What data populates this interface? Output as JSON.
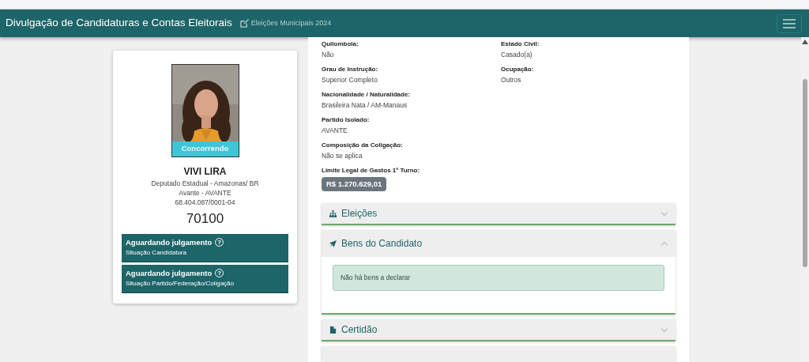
{
  "navbar": {
    "title": "Divulgação de Candidaturas e Contas Eleitorais",
    "subtitle": "Eleições Municipais 2024"
  },
  "candidate": {
    "status_band": "Concorrendo",
    "name": "VIVI LIRA",
    "office": "Deputado Estadual - Amazonas/ BR",
    "party": "Avante - AVANTE",
    "cnpj": "68.404.087/0001-04",
    "number": "70100",
    "situations": [
      {
        "title": "Aguardando julgamento",
        "help": "?",
        "caption": "Situação Candidatura"
      },
      {
        "title": "Aguardando julgamento",
        "help": "?",
        "caption": "Situação Partido/Federação/Coligação"
      }
    ]
  },
  "details_left": [
    {
      "label": "Quilombola:",
      "value": "Não"
    },
    {
      "label": "Grau de Instrução:",
      "value": "Superior Completo"
    },
    {
      "label": "Nacionalidade / Naturalidade:",
      "value": "Brasileira Nata / AM-Manaus"
    },
    {
      "label": "Partido Isolado:",
      "value": "AVANTE"
    },
    {
      "label": "Composição da Coligação:",
      "value": "Não se aplica"
    }
  ],
  "details_right": [
    {
      "label": "Estado Civil:",
      "value": "Casado(a)"
    },
    {
      "label": "Ocupação:",
      "value": "Outros"
    }
  ],
  "spending_limit": {
    "label": "Limite Legal de Gastos 1º Turno:",
    "value": "R$ 1.270.629,01"
  },
  "accordion": [
    {
      "title": "Eleições",
      "expanded": false
    },
    {
      "title": "Bens do Candidato",
      "expanded": true,
      "alert": "Não há bens a declarar"
    },
    {
      "title": "Certidão",
      "expanded": false
    }
  ]
}
